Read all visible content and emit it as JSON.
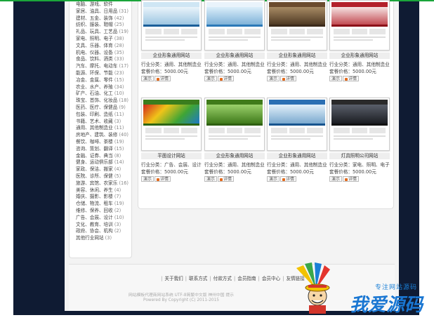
{
  "colors": {
    "accent": "#1aa53a",
    "frame": "#0f1b33",
    "orange": "#e46a1c"
  },
  "sidebar": {
    "categories": [
      {
        "label": "电脑、游戏、软件",
        "count": ""
      },
      {
        "label": "家居、油具、日用品",
        "count": "(31)"
      },
      {
        "label": "建材、五金、装饰",
        "count": "(42)"
      },
      {
        "label": "纺织、服装、鞋帽",
        "count": "(25)"
      },
      {
        "label": "礼品、玩具、工艺品",
        "count": "(19)"
      },
      {
        "label": "家电、照明、电子",
        "count": "(38)"
      },
      {
        "label": "文具、乐器、体育",
        "count": "(28)"
      },
      {
        "label": "机电、仪器、设备",
        "count": "(35)"
      },
      {
        "label": "食品、饮料、酒类",
        "count": "(33)"
      },
      {
        "label": "汽车、摩托、电动车",
        "count": "(17)"
      },
      {
        "label": "能源、环保、节能",
        "count": "(23)"
      },
      {
        "label": "冶金、金属、零件",
        "count": "(15)"
      },
      {
        "label": "农业、水产、养殖",
        "count": "(34)"
      },
      {
        "label": "矿产、石油、化工",
        "count": "(10)"
      },
      {
        "label": "珠宝、首饰、化妆品",
        "count": "(18)"
      },
      {
        "label": "医药、医疗、保健品",
        "count": "(9)"
      },
      {
        "label": "包装、印刷、造纸",
        "count": "(11)"
      },
      {
        "label": "书籍、艺术、收藏",
        "count": "(3)"
      },
      {
        "label": "通用、其他制造业",
        "count": "(11)"
      },
      {
        "label": "房地产、建筑、装修",
        "count": "(40)"
      },
      {
        "label": "餐饮、咖啡、茶楼",
        "count": "(19)"
      },
      {
        "label": "咨询、策划、翻译",
        "count": "(15)"
      },
      {
        "label": "金融、证券、典当",
        "count": "(8)"
      },
      {
        "label": "健身、运动俱乐部",
        "count": "(14)"
      },
      {
        "label": "家政、保洁、搬家",
        "count": "(4)"
      },
      {
        "label": "医院、诊所、保健",
        "count": "(5)"
      },
      {
        "label": "旅游、宾馆、农家乐",
        "count": "(16)"
      },
      {
        "label": "美容、休闲、养生",
        "count": "(4)"
      },
      {
        "label": "婚庆、摄影、影楼",
        "count": "(7)"
      },
      {
        "label": "仓储、物流、租车",
        "count": "(19)"
      },
      {
        "label": "维修、保养、回收",
        "count": "(2)"
      },
      {
        "label": "广告、会展、设计",
        "count": "(10)"
      },
      {
        "label": "文化、教育、培训",
        "count": "(3)"
      },
      {
        "label": "政府、协会、机构",
        "count": "(2)"
      },
      {
        "label": "其他行业网站",
        "count": "(3)"
      }
    ]
  },
  "templates": [
    {
      "title": "企业形象通用网站",
      "line1": "行业分类：通用、其他制造业",
      "line2": "套餐价格：5000.00元",
      "preview": "演示",
      "detail": "详情"
    },
    {
      "title": "企业形象通用网站",
      "line1": "行业分类：通用、其他制造业",
      "line2": "套餐价格：5000.00元",
      "preview": "演示",
      "detail": "详情"
    },
    {
      "title": "企业形象通用网站",
      "line1": "行业分类：通用、其他制造业",
      "line2": "套餐价格：5000.00元",
      "preview": "演示",
      "detail": "详情"
    },
    {
      "title": "企业形象通用网站",
      "line1": "行业分类：通用、其他制造业",
      "line2": "套餐价格：5000.00元",
      "preview": "演示",
      "detail": "详情"
    },
    {
      "title": "平面设计网站",
      "line1": "行业分类：广告、会展、设计",
      "line2": "套餐价格：5000.00元",
      "preview": "演示",
      "detail": "详情"
    },
    {
      "title": "企业形象通用网站",
      "line1": "行业分类：通用、其他制造业",
      "line2": "套餐价格：5000.00元",
      "preview": "演示",
      "detail": "详情"
    },
    {
      "title": "企业形象通用网站",
      "line1": "行业分类：通用、其他制造业",
      "line2": "套餐价格：5000.00元",
      "preview": "演示",
      "detail": "详情"
    },
    {
      "title": "灯具照明公司网站",
      "line1": "行业分类：家电、照明、电子",
      "line2": "套餐价格：5000.00元",
      "preview": "演示",
      "detail": "详情"
    }
  ],
  "footer": {
    "links": [
      "关于我们",
      "联系方式",
      "付款方式",
      "会员指南",
      "会员中心",
      "友情链接"
    ],
    "line1": "网站模板代理商网站系统 UTF-8简繁中文版 神州中国 提示",
    "line2": "Powered By Copyright (C) 2011-2015"
  },
  "watermark": {
    "tagline": "专注网站源码",
    "brand": "我爱源码"
  }
}
